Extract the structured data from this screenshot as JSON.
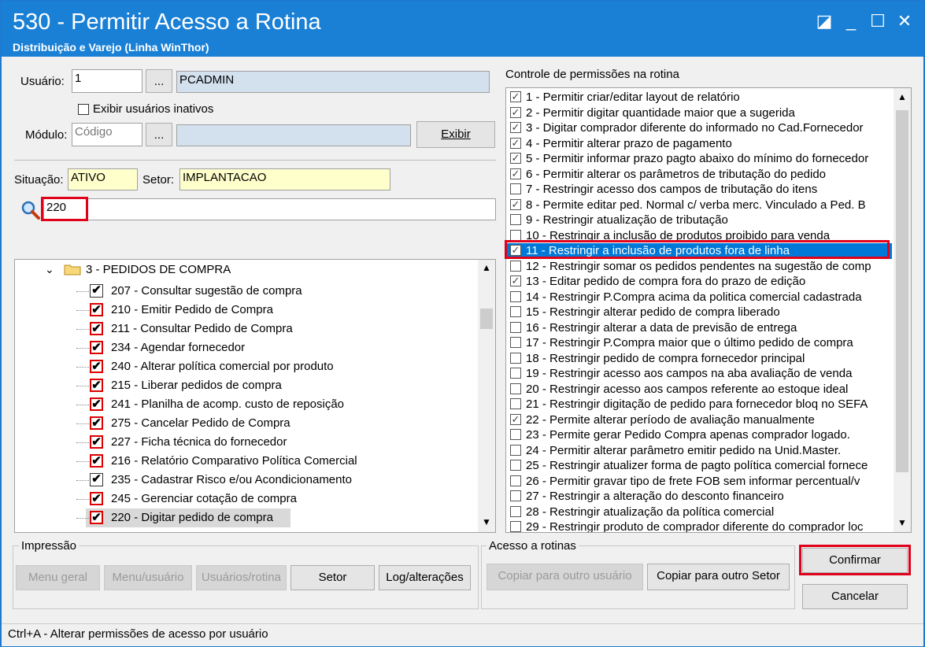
{
  "window": {
    "title": "530 - Permitir Acesso a Rotina",
    "subtitle": "Distribuição e Varejo (Linha WinThor)",
    "controls": {
      "restore": "◪",
      "minimize": "_",
      "maximize": "☐",
      "close": "✕"
    }
  },
  "form": {
    "usuario_label": "Usuário:",
    "usuario_code": "1",
    "usuario_name": "PCADMIN",
    "ellipsis": "...",
    "inativos_label": "Exibir usuários inativos",
    "modulo_label": "Módulo:",
    "modulo_placeholder": "Código",
    "exibir_label": "Exibir",
    "situacao_label": "Situação:",
    "situacao_value": "ATIVO",
    "setor_label": "Setor:",
    "setor_value": "IMPLANTACAO",
    "search_value": "220"
  },
  "tree": {
    "group_label": "3 - PEDIDOS DE COMPRA",
    "items": [
      {
        "label": "207 - Consultar sugestão de compra",
        "red": false
      },
      {
        "label": "210 - Emitir Pedido de Compra",
        "red": true
      },
      {
        "label": "211 - Consultar Pedido de Compra",
        "red": true
      },
      {
        "label": "234 - Agendar fornecedor",
        "red": true
      },
      {
        "label": "240 - Alterar política comercial por produto",
        "red": true
      },
      {
        "label": "215 - Liberar pedidos de compra",
        "red": true
      },
      {
        "label": "241 - Planilha de acomp. custo de reposição",
        "red": true
      },
      {
        "label": "275 - Cancelar Pedido de Compra",
        "red": true
      },
      {
        "label": "227 - Ficha técnica do fornecedor",
        "red": true
      },
      {
        "label": "216 - Relatório Comparativo Política Comercial",
        "red": true
      },
      {
        "label": "235 - Cadastrar Risco e/ou Acondicionamento",
        "red": false
      },
      {
        "label": "245 - Gerenciar cotação de compra",
        "red": true
      },
      {
        "label": "220 - Digitar pedido de compra",
        "red": true,
        "highlight": true
      }
    ]
  },
  "permissions": {
    "title": "Controle de permissões na rotina",
    "items": [
      {
        "label": "1 - Permitir criar/editar layout de relatório",
        "checked": true
      },
      {
        "label": "2 - Permitir digitar quantidade maior que a sugerida",
        "checked": true
      },
      {
        "label": "3 - Digitar comprador diferente do informado no Cad.Fornecedor",
        "checked": true
      },
      {
        "label": "4 - Permitir alterar prazo de pagamento",
        "checked": true
      },
      {
        "label": "5 - Permitir informar prazo pagto abaixo do mínimo do fornecedor",
        "checked": true
      },
      {
        "label": "6 - Permitir alterar os parâmetros de tributação do pedido",
        "checked": true
      },
      {
        "label": "7 - Restringir acesso dos campos de tributação do itens",
        "checked": false
      },
      {
        "label": "8 - Permite editar ped. Normal c/ verba merc. Vinculado a Ped. B",
        "checked": true
      },
      {
        "label": "9 - Restringir atualização de tributação",
        "checked": false
      },
      {
        "label": "10 - Restringir a inclusão de produtos proibido para venda",
        "checked": false
      },
      {
        "label": "11 - Restringir a inclusão de produtos fora de linha",
        "checked": true,
        "selected": true
      },
      {
        "label": "12 - Restringir somar os pedidos pendentes na sugestão de comp",
        "checked": false
      },
      {
        "label": "13 - Editar pedido de compra fora do prazo de edição",
        "checked": true
      },
      {
        "label": "14 - Restringir P.Compra acima da politica comercial cadastrada",
        "checked": false
      },
      {
        "label": "15 - Restringir alterar pedido de compra liberado",
        "checked": false
      },
      {
        "label": "16 - Restringir alterar a data de previsão de entrega",
        "checked": false
      },
      {
        "label": "17 - Restringir P.Compra maior que o último pedido de compra",
        "checked": false
      },
      {
        "label": "18 - Restringir pedido de compra fornecedor principal",
        "checked": false
      },
      {
        "label": "19 - Restringir acesso aos campos na aba avaliação de venda",
        "checked": false
      },
      {
        "label": "20 - Restringir acesso aos campos referente ao estoque ideal",
        "checked": false
      },
      {
        "label": "21 - Restringir digitação de pedido para fornecedor bloq no SEFA",
        "checked": false
      },
      {
        "label": "22 - Permite alterar período de avaliação manualmente",
        "checked": true
      },
      {
        "label": "23 - Permite gerar Pedido Compra apenas comprador logado.",
        "checked": false
      },
      {
        "label": "24 - Permitir alterar parâmetro emitir pedido na Unid.Master.",
        "checked": false
      },
      {
        "label": "25 - Restringir atualizer forma de pagto política comercial fornece",
        "checked": false
      },
      {
        "label": "26 - Permitir gravar tipo de frete FOB sem informar percentual/v",
        "checked": false
      },
      {
        "label": "27 - Restringir a alteração do desconto financeiro",
        "checked": false
      },
      {
        "label": "28 - Restringir atualização da política comercial",
        "checked": false
      },
      {
        "label": "29 - Restringir produto de comprador diferente do comprador loc",
        "checked": false
      }
    ]
  },
  "impressao": {
    "title": "Impressão",
    "menu_geral": "Menu geral",
    "menu_usuario": "Menu/usuário",
    "usuarios_rotina": "Usuários/rotina",
    "setor": "Setor",
    "log": "Log/alterações"
  },
  "acesso": {
    "title": "Acesso a rotinas",
    "copiar_usuario": "Copiar para outro usuário",
    "copiar_setor": "Copiar para outro Setor"
  },
  "actions": {
    "confirmar": "Confirmar",
    "cancelar": "Cancelar"
  },
  "status": "Ctrl+A - Alterar permissões de acesso por usuário"
}
